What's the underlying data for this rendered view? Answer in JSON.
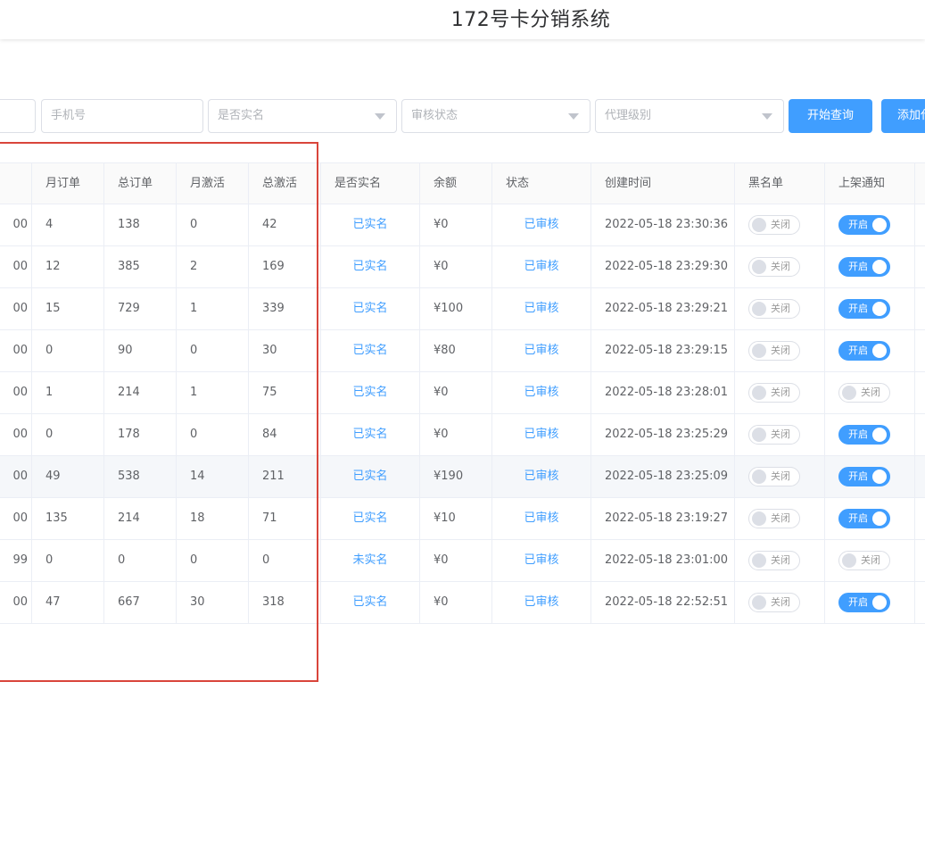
{
  "app": {
    "title": "172号卡分销系统"
  },
  "filters": {
    "phone_placeholder": "手机号",
    "realname_placeholder": "是否实名",
    "review_placeholder": "审核状态",
    "level_placeholder": "代理级别"
  },
  "buttons": {
    "search": "开始查询",
    "add": "添加代理"
  },
  "table": {
    "columns": [
      "",
      "月订单",
      "总订单",
      "月激活",
      "总激活",
      "是否实名",
      "余额",
      "状态",
      "创建时间",
      "黑名单",
      "上架通知"
    ],
    "rows": [
      {
        "id_tail": "00",
        "month_orders": "4",
        "total_orders": "138",
        "month_act": "0",
        "total_act": "42",
        "realname": "已实名",
        "balance": "¥0",
        "status": "已审核",
        "created": "2022-05-18 23:30:36",
        "blacklist": "关闭",
        "blacklist_on": false,
        "notify": "开启",
        "notify_on": true
      },
      {
        "id_tail": "00",
        "month_orders": "12",
        "total_orders": "385",
        "month_act": "2",
        "total_act": "169",
        "realname": "已实名",
        "balance": "¥0",
        "status": "已审核",
        "created": "2022-05-18 23:29:30",
        "blacklist": "关闭",
        "blacklist_on": false,
        "notify": "开启",
        "notify_on": true
      },
      {
        "id_tail": "00",
        "month_orders": "15",
        "total_orders": "729",
        "month_act": "1",
        "total_act": "339",
        "realname": "已实名",
        "balance": "¥100",
        "status": "已审核",
        "created": "2022-05-18 23:29:21",
        "blacklist": "关闭",
        "blacklist_on": false,
        "notify": "开启",
        "notify_on": true
      },
      {
        "id_tail": "00",
        "month_orders": "0",
        "total_orders": "90",
        "month_act": "0",
        "total_act": "30",
        "realname": "已实名",
        "balance": "¥80",
        "status": "已审核",
        "created": "2022-05-18 23:29:15",
        "blacklist": "关闭",
        "blacklist_on": false,
        "notify": "开启",
        "notify_on": true
      },
      {
        "id_tail": "00",
        "month_orders": "1",
        "total_orders": "214",
        "month_act": "1",
        "total_act": "75",
        "realname": "已实名",
        "balance": "¥0",
        "status": "已审核",
        "created": "2022-05-18 23:28:01",
        "blacklist": "关闭",
        "blacklist_on": false,
        "notify": "关闭",
        "notify_on": false
      },
      {
        "id_tail": "00",
        "month_orders": "0",
        "total_orders": "178",
        "month_act": "0",
        "total_act": "84",
        "realname": "已实名",
        "balance": "¥0",
        "status": "已审核",
        "created": "2022-05-18 23:25:29",
        "blacklist": "关闭",
        "blacklist_on": false,
        "notify": "开启",
        "notify_on": true
      },
      {
        "id_tail": "00",
        "month_orders": "49",
        "total_orders": "538",
        "month_act": "14",
        "total_act": "211",
        "realname": "已实名",
        "balance": "¥190",
        "status": "已审核",
        "created": "2022-05-18 23:25:09",
        "blacklist": "关闭",
        "blacklist_on": false,
        "notify": "开启",
        "notify_on": true
      },
      {
        "id_tail": "00",
        "month_orders": "135",
        "total_orders": "214",
        "month_act": "18",
        "total_act": "71",
        "realname": "已实名",
        "balance": "¥10",
        "status": "已审核",
        "created": "2022-05-18 23:19:27",
        "blacklist": "关闭",
        "blacklist_on": false,
        "notify": "开启",
        "notify_on": true
      },
      {
        "id_tail": "99",
        "month_orders": "0",
        "total_orders": "0",
        "month_act": "0",
        "total_act": "0",
        "realname": "未实名",
        "balance": "¥0",
        "status": "已审核",
        "created": "2022-05-18 23:01:00",
        "blacklist": "关闭",
        "blacklist_on": false,
        "notify": "关闭",
        "notify_on": false
      },
      {
        "id_tail": "00",
        "month_orders": "47",
        "total_orders": "667",
        "month_act": "30",
        "total_act": "318",
        "realname": "已实名",
        "balance": "¥0",
        "status": "已审核",
        "created": "2022-05-18 22:52:51",
        "blacklist": "关闭",
        "blacklist_on": false,
        "notify": "开启",
        "notify_on": true
      }
    ]
  },
  "colors": {
    "accent": "#409eff",
    "annotation": "#d9453b"
  }
}
